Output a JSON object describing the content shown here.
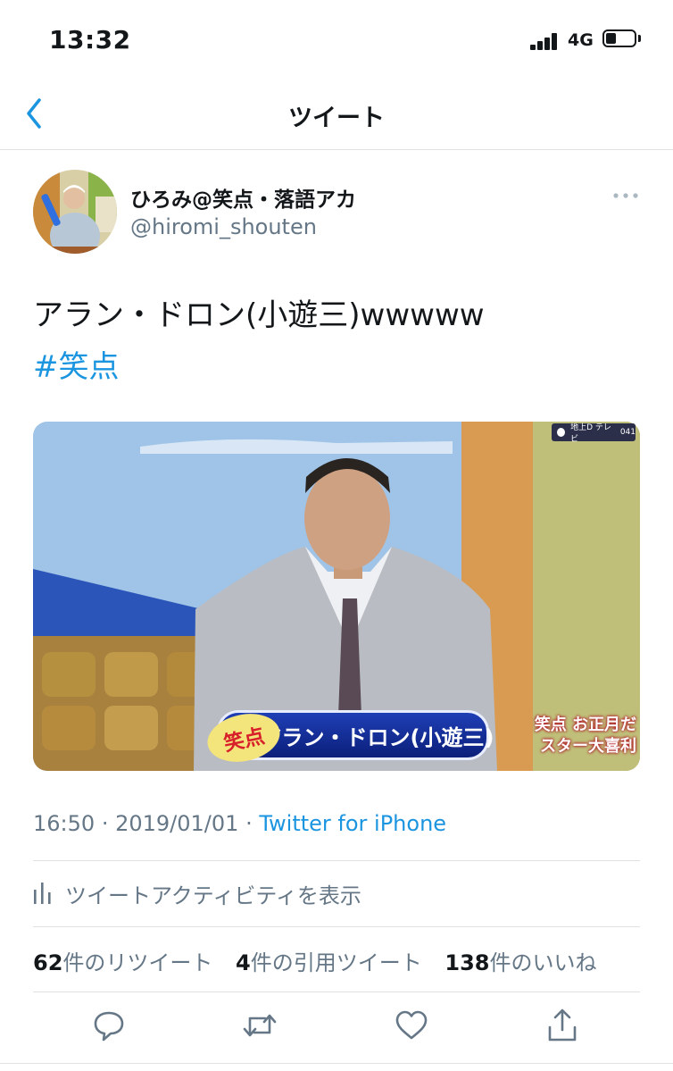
{
  "status_bar": {
    "time": "13:32",
    "network": "4G"
  },
  "nav": {
    "title": "ツイート"
  },
  "author": {
    "display_name": "ひろみ@笑点・落語アカ",
    "handle": "@hiromi_shouten"
  },
  "tweet": {
    "text": "アラン・ドロン(小遊三)wwwww",
    "hashtag": "#笑点"
  },
  "media": {
    "caption_tag": "笑点",
    "caption": "アラン・ドロン(小遊三)",
    "corner_caption_line1": "笑点 お正月だ",
    "corner_caption_line2": "スター大喜利",
    "channel_label": "地上D テレビ",
    "channel_number": "041"
  },
  "meta": {
    "time": "16:50",
    "separator": "·",
    "date": "2019/01/01",
    "source": "Twitter for iPhone"
  },
  "activity": {
    "label": "ツイートアクティビティを表示"
  },
  "stats": {
    "retweets": {
      "count": "62",
      "label": "件のリツイート"
    },
    "quotes": {
      "count": "4",
      "label": "件の引用ツイート"
    },
    "likes": {
      "count": "138",
      "label": "件のいいね"
    }
  },
  "colors": {
    "link": "#1b95e0",
    "secondary_text": "#657786",
    "primary_text": "#14171a",
    "divider": "#dfe1e3"
  },
  "icons": [
    "back-chevron-icon",
    "more-icon",
    "activity-bars-icon",
    "reply-icon",
    "retweet-icon",
    "like-icon",
    "share-icon"
  ]
}
